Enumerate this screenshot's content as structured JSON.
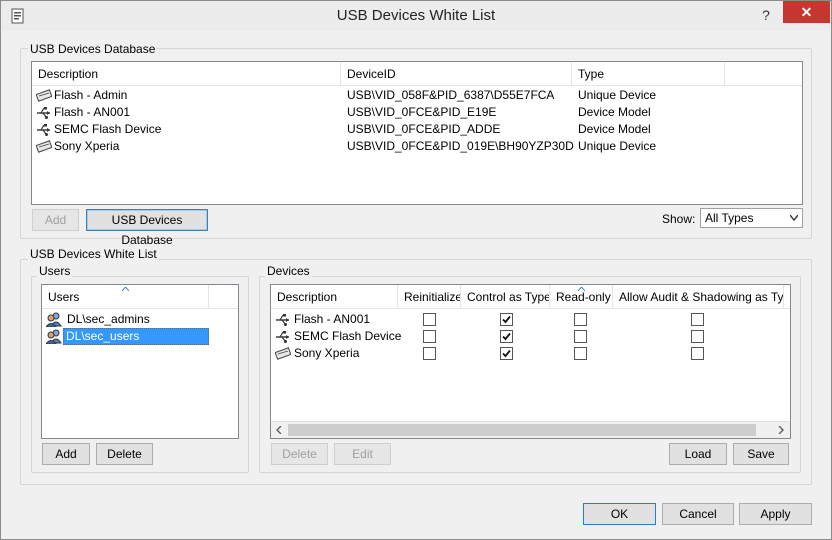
{
  "window": {
    "title": "USB Devices White List",
    "help_label": "?",
    "close_label": "✕"
  },
  "database": {
    "group_label": "USB Devices Database",
    "columns": [
      "Description",
      "DeviceID",
      "Type"
    ],
    "rows": [
      {
        "description": "Flash - Admin",
        "device_id": "USB\\VID_058F&PID_6387\\D55E7FCA",
        "type": "Unique Device",
        "icon": "unique-device-icon"
      },
      {
        "description": "Flash - AN001",
        "device_id": "USB\\VID_0FCE&PID_E19E",
        "type": "Device Model",
        "icon": "usb-symbol-icon"
      },
      {
        "description": "SEMC Flash Device",
        "device_id": "USB\\VID_0FCE&PID_ADDE",
        "type": "Device Model",
        "icon": "usb-symbol-icon"
      },
      {
        "description": "Sony Xperia",
        "device_id": "USB\\VID_0FCE&PID_019E\\BH90YZP30D",
        "type": "Unique Device",
        "icon": "unique-device-icon"
      }
    ],
    "add_label": "Add",
    "db_button_label": "USB Devices Database",
    "show_label": "Show:",
    "show_value": "All Types"
  },
  "whitelist": {
    "group_label": "USB Devices White List",
    "users": {
      "group_label": "Users",
      "column": "Users",
      "items": [
        {
          "name": "DL\\sec_admins",
          "selected": false
        },
        {
          "name": "DL\\sec_users",
          "selected": true
        }
      ],
      "add_label": "Add",
      "delete_label": "Delete"
    },
    "devices": {
      "group_label": "Devices",
      "columns": [
        "Description",
        "Reinitialize",
        "Control as Type",
        "Read-only",
        "Allow Audit & Shadowing as Type"
      ],
      "rows": [
        {
          "description": "Flash - AN001",
          "reinitialize": false,
          "control_as_type": true,
          "read_only": false,
          "audit": false
        },
        {
          "description": "SEMC Flash Device",
          "reinitialize": false,
          "control_as_type": true,
          "read_only": false,
          "audit": false
        },
        {
          "description": "Sony Xperia",
          "reinitialize": false,
          "control_as_type": true,
          "read_only": false,
          "audit": false
        }
      ],
      "delete_label": "Delete",
      "edit_label": "Edit",
      "load_label": "Load",
      "save_label": "Save"
    }
  },
  "footer": {
    "ok_label": "OK",
    "cancel_label": "Cancel",
    "apply_label": "Apply"
  },
  "colors": {
    "selection": "#3399ff",
    "close_button": "#c7372f",
    "default_button_border": "#2b79d6"
  }
}
